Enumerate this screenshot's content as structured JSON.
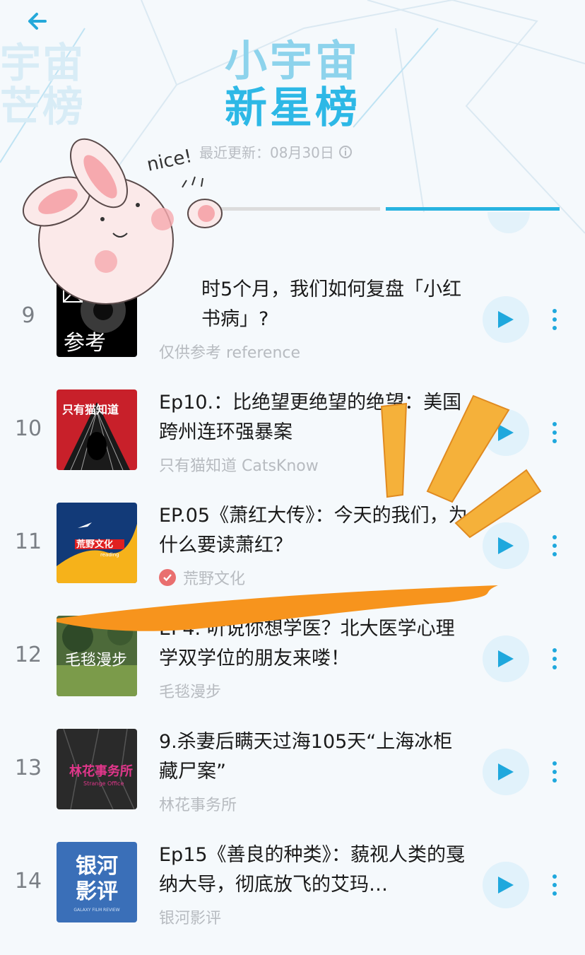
{
  "header": {
    "side_title_line1": "宇宙",
    "side_title_line2": "芒榜",
    "title_top": "小宇宙",
    "title_main": "新星榜",
    "update_text": "最近更新：08月30日"
  },
  "sticker": {
    "text": "nice!"
  },
  "colors": {
    "accent": "#2db8e6",
    "play_bg": "#e1f2fb",
    "verified": "#e96f6f"
  },
  "episodes": [
    {
      "rank": "9",
      "title": "时5个月，我们如何复盘「小红书病」?",
      "author": "仅供参考 reference",
      "cover": {
        "text": "参考",
        "bg": "#000000"
      }
    },
    {
      "rank": "10",
      "title": "Ep10.：比绝望更绝望的绝望：美国跨州连环强暴案",
      "author": "只有猫知道 CatsKnow",
      "cover": {
        "text": "只有猫知道",
        "bg": "#c8202a"
      }
    },
    {
      "rank": "11",
      "title": "EP.05《萧红大传》：今天的我们，为什么要读萧红？",
      "author": "荒野文化",
      "verified": true,
      "cover": {
        "text": "荒野文化",
        "subtext": "reading",
        "bg": "#123a78"
      }
    },
    {
      "rank": "12",
      "title": "EP4. 听说你想学医？北大医学心理学双学位的朋友来喽！",
      "author": "毛毯漫步",
      "cover": {
        "text": "毛毯漫步",
        "bg": "#4d6a3a"
      }
    },
    {
      "rank": "13",
      "title": "9.杀妻后瞒天过海105天“上海冰柜藏尸案”",
      "author": "林花事务所",
      "cover": {
        "text": "林花事务所",
        "subtext": "Strange Office",
        "bg": "#2a2a2a"
      }
    },
    {
      "rank": "14",
      "title": "Ep15《善良的种类》：藐视人类的戛纳大导，彻底放飞的艾玛…",
      "author": "银河影评",
      "cover": {
        "text": "银河影评",
        "subtext": "GALAXY FILM REVIEW",
        "bg": "#3a6fb8"
      }
    }
  ]
}
